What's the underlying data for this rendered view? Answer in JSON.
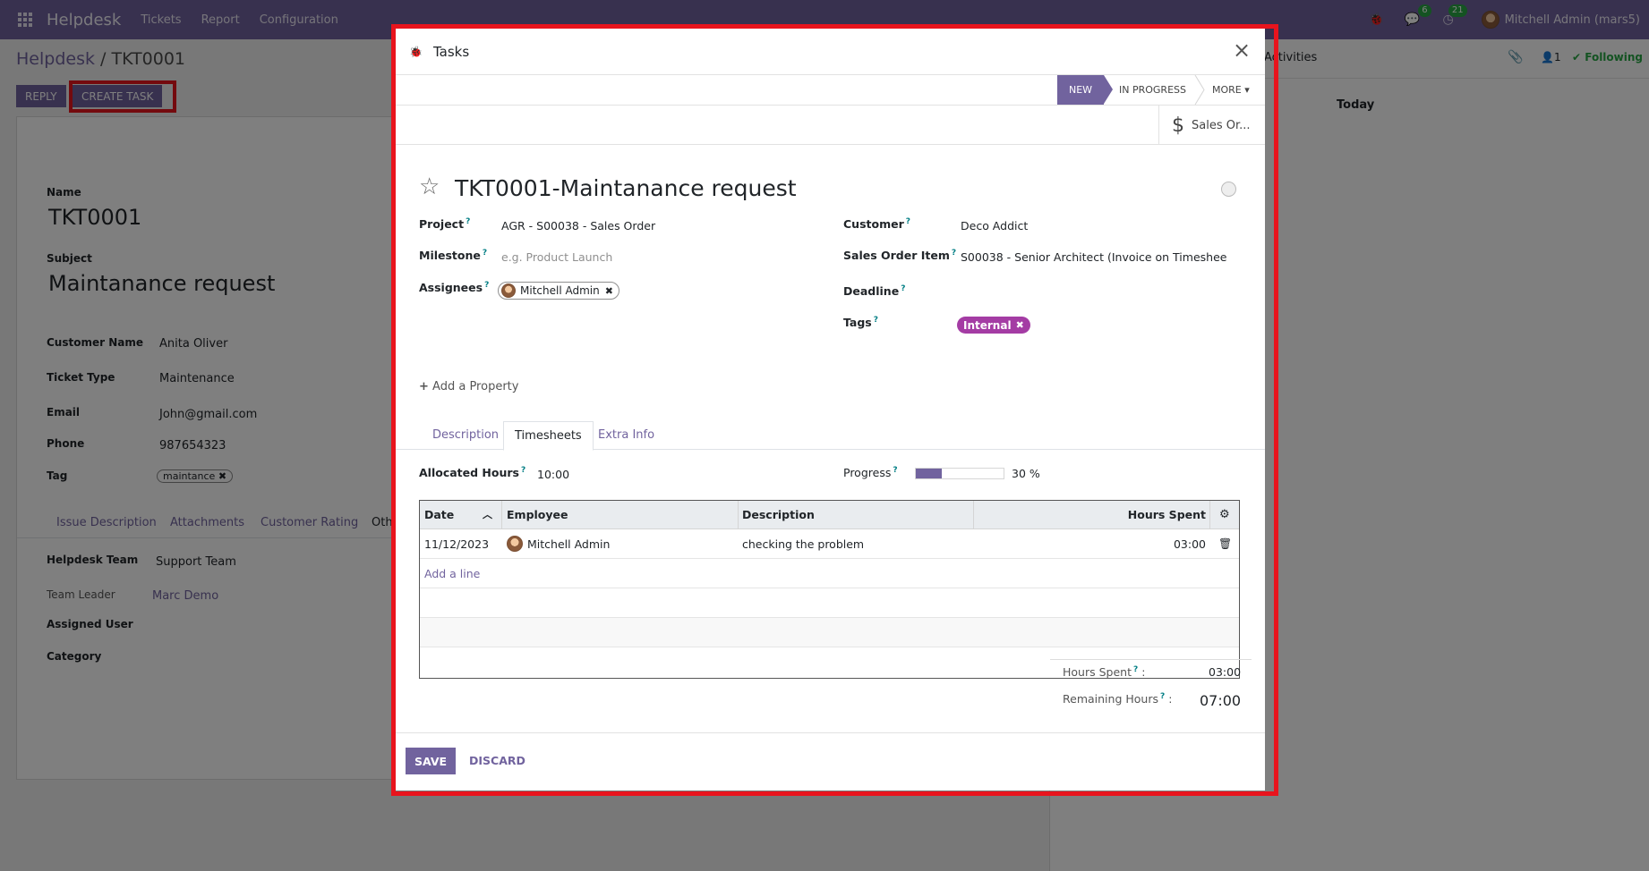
{
  "topbar": {
    "app_name": "Helpdesk",
    "menu": [
      "Tickets",
      "Report",
      "Configuration"
    ],
    "chat_badge": "6",
    "activity_badge": "21",
    "user_name": "Mitchell Admin (mars5)"
  },
  "background": {
    "breadcrumb_root": "Helpdesk",
    "breadcrumb_sep": "/",
    "breadcrumb_current": "TKT0001",
    "reply_label": "REPLY",
    "create_task_label": "CREATE TASK",
    "activities_label": "Activities",
    "follower_count": "1",
    "following_label": "Following",
    "today_label": "Today",
    "name_label": "Name",
    "name_value": "TKT0001",
    "subject_label": "Subject",
    "subject_value": "Maintanance request",
    "customer_name_label": "Customer Name",
    "customer_name_value": "Anita Oliver",
    "ticket_type_label": "Ticket Type",
    "ticket_type_value": "Maintenance",
    "email_label": "Email",
    "email_value": "John@gmail.com",
    "phone_label": "Phone",
    "phone_value": "987654323",
    "tag_label": "Tag",
    "tag_value": "maintance",
    "tabs": [
      "Issue Description",
      "Attachments",
      "Customer Rating",
      "Oth"
    ],
    "helpdesk_team_label": "Helpdesk Team",
    "helpdesk_team_value": "Support Team",
    "team_leader_label": "Team Leader",
    "team_leader_value": "Marc Demo",
    "assigned_user_label": "Assigned User",
    "category_label": "Category"
  },
  "modal": {
    "title": "Tasks",
    "stages": {
      "new": "NEW",
      "in_progress": "IN PROGRESS",
      "more": "MORE"
    },
    "smart_button": "Sales Or...",
    "task_name": "TKT0001-Maintanance request",
    "fields": {
      "project_label": "Project",
      "project_value": "AGR - S00038 - Sales Order",
      "milestone_label": "Milestone",
      "milestone_placeholder": "e.g. Product Launch",
      "assignees_label": "Assignees",
      "assignee": "Mitchell Admin",
      "customer_label": "Customer",
      "customer_value": "Deco Addict",
      "sales_order_item_label": "Sales Order Item",
      "sales_order_item_value": "S00038 - Senior Architect (Invoice on Timeshee",
      "deadline_label": "Deadline",
      "tags_label": "Tags",
      "tag": "Internal"
    },
    "add_property": "Add a Property",
    "tabs": [
      "Description",
      "Timesheets",
      "Extra Info"
    ],
    "allocated_hours_label": "Allocated Hours",
    "allocated_hours_value": "10:00",
    "progress_label": "Progress",
    "progress_percent": 30,
    "progress_text": "30 %",
    "timesheet": {
      "columns": [
        "Date",
        "Employee",
        "Description",
        "Hours Spent"
      ],
      "rows": [
        {
          "date": "11/12/2023",
          "employee": "Mitchell Admin",
          "description": "checking the problem",
          "hours": "03:00"
        }
      ],
      "add_line": "Add a line"
    },
    "hours_spent_label": "Hours Spent",
    "hours_spent_value": "03:00",
    "remaining_hours_label": "Remaining Hours",
    "remaining_hours_value": "07:00",
    "save_label": "SAVE",
    "discard_label": "DISCARD"
  },
  "colors": {
    "brand": "#71639e",
    "highlight": "#e8141d",
    "tag_internal": "#a43ca4",
    "badge": "#28a745"
  }
}
